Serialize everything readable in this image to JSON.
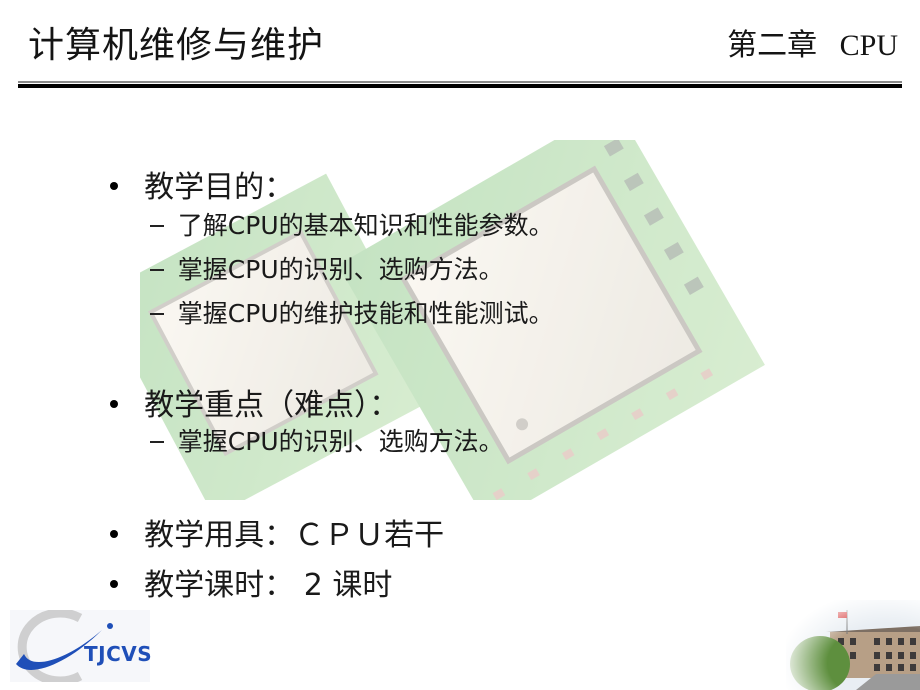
{
  "header": {
    "title": "计算机维修与维护",
    "chapter": "第二章   CPU"
  },
  "sections": [
    {
      "heading": "教学目的：",
      "items": [
        "了解CPU的基本知识和性能参数。",
        "掌握CPU的识别、选购方法。",
        "掌握CPU的维护技能和性能测试。"
      ]
    },
    {
      "heading": "教学重点（难点）：",
      "items": [
        "掌握CPU的识别、选购方法。"
      ]
    },
    {
      "heading": "教学用具：ＣＰＵ若干",
      "items": []
    },
    {
      "heading": "教学课时： 2 课时",
      "items": []
    }
  ],
  "footer": {
    "logo_text": "TJCVS",
    "colors": {
      "logo_blue": "#1f4fb8",
      "logo_gray": "#c8c8c8",
      "flag_red": "#d22b2b"
    }
  },
  "background": {
    "image": "cpu-photo"
  }
}
